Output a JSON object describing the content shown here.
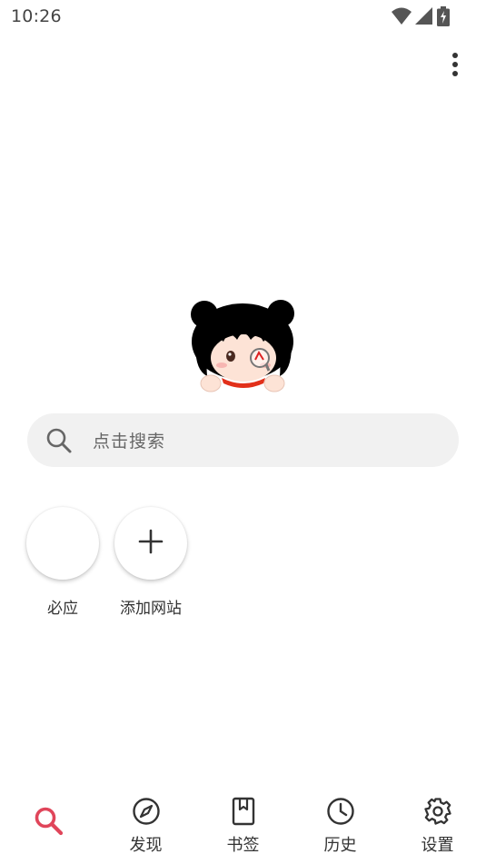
{
  "status_bar": {
    "time": "10:26",
    "icons": [
      "wifi-icon",
      "cell-signal-icon",
      "battery-charging-icon"
    ]
  },
  "toolbar": {
    "more_icon": "more-vert-icon"
  },
  "search": {
    "placeholder": "点击搜索",
    "icon": "search-icon"
  },
  "shortcuts": [
    {
      "label": "必应",
      "icon": ""
    },
    {
      "label": "添加网站",
      "icon": "plus-icon"
    }
  ],
  "bottom_nav": {
    "items": [
      {
        "label": "",
        "icon": "search-icon",
        "active": true
      },
      {
        "label": "发现",
        "icon": "compass-icon",
        "active": false
      },
      {
        "label": "书签",
        "icon": "bookmark-icon",
        "active": false
      },
      {
        "label": "历史",
        "icon": "clock-icon",
        "active": false
      },
      {
        "label": "设置",
        "icon": "gear-icon",
        "active": false
      }
    ]
  },
  "colors": {
    "accent": "#e0455a",
    "search_bg": "#f1f1f1",
    "icon": "#333333"
  }
}
